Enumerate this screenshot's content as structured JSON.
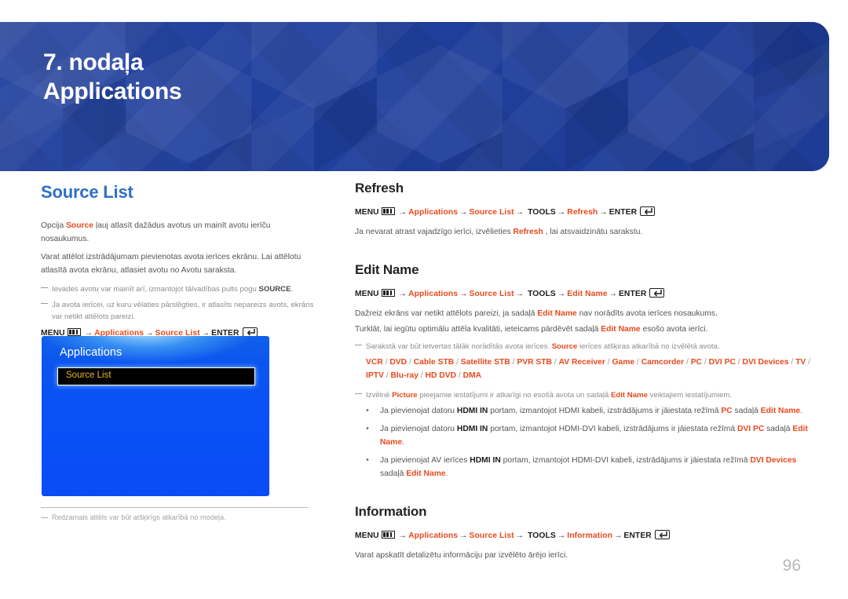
{
  "banner": {
    "chapter_number": "7. nodaļa",
    "chapter_title": "Applications",
    "bg_color": "#1f3f9d"
  },
  "page": {
    "number": "96"
  },
  "left_column": {
    "heading": "Source List",
    "heading_color": "#2e6fc7",
    "paragraph1_pre": "Opcija ",
    "paragraph1_kw": "Source",
    "paragraph1_post": " ļauj atlasīt dažādus avotus un mainīt avotu ierīču nosaukumus.",
    "paragraph2": "Varat attēlot izstrādājumam pievienotas avota ierīces ekrānu. Lai attēlotu atlasītā avota ekrānu, atlasiet avotu no Avotu saraksta.",
    "note1_pre": "Ievades avotu var mainīt arī, izmantojot tālvadības pults pogu ",
    "note1_kw": "SOURCE",
    "note1_post": ".",
    "note2": "Ja avota ierīcei, uz kuru vēlaties pārslēgties, ir atlasīts nepareizs avots, ekrāns var netikt attēlots pareizi.",
    "menu_path": {
      "menu_label": "MENU",
      "menu_icon": "menu-bars-icon",
      "steps": [
        "Applications",
        "Source List"
      ],
      "enter_label": "ENTER",
      "enter_icon": "enter-return-icon"
    },
    "tv_mockup": {
      "title": "Applications",
      "selected_item": "Source List",
      "selected_text_color": "#e8b62b"
    },
    "footnote": "Redzamais attēls var būt atšķirīgs atkarībā no modeļa."
  },
  "right_column": {
    "sections": [
      {
        "heading": "Refresh",
        "menu_path": {
          "menu_label": "MENU",
          "menu_icon": "menu-bars-icon",
          "steps": [
            "Applications",
            "Source List",
            "TOOLS",
            "Refresh"
          ],
          "enter_label": "ENTER",
          "enter_icon": "enter-return-icon"
        },
        "body_pre": "Ja nevarat atrast vajadzīgo ierīci, izvēlieties ",
        "body_kw": "Refresh",
        "body_post": " , lai atsvaidzinātu sarakstu."
      },
      {
        "heading": "Edit Name",
        "menu_path": {
          "menu_label": "MENU",
          "menu_icon": "menu-bars-icon",
          "steps": [
            "Applications",
            "Source List",
            "TOOLS",
            "Edit Name"
          ],
          "enter_label": "ENTER",
          "enter_icon": "enter-return-icon"
        },
        "para1_pre": "Dažreiz ekrāns var netikt attēlots pareizi, ja sadaļā ",
        "para1_kw": "Edit Name",
        "para1_post": " nav norādīts avota ierīces nosaukums.",
        "para2_pre": "Turklāt, lai iegūtu optimālu attēla kvalitāti, ieteicams pārdēvēt sadaļā ",
        "para2_kw": "Edit Name",
        "para2_post": " esošo avota ierīci.",
        "note1_pre": "Sarakstā var būt ietvertas tālāk norādītās avota ierīces. ",
        "note1_kw": "Source",
        "note1_post": " ierīces atšķiras atkarībā no izvēlētā avota.",
        "device_list": [
          "VCR",
          "DVD",
          "Cable STB",
          "Satellite STB",
          "PVR STB",
          "AV Receiver",
          "Game",
          "Camcorder",
          "PC",
          "DVI PC",
          "DVI Devices",
          "TV",
          "IPTV",
          "Blu-ray",
          "HD DVD",
          "DMA"
        ],
        "note2_pre": "Izvēlnē ",
        "note2_kw1": "Picture",
        "note2_mid": " pieejamie iestatījumi ir atkarīgi no esošā avota un sadaļā ",
        "note2_kw2": "Edit Name",
        "note2_post": " veiktajiem iestatījumiem.",
        "bullets": [
          {
            "seg1": "Ja pievienojat datoru ",
            "kw_black": "HDMI IN",
            "seg2": " portam, izmantojot HDMI kabeli, izstrādājums ir jāiestata režīmā ",
            "kw_red1": "PC",
            "seg3": " sadaļā ",
            "kw_red2": "Edit Name",
            "seg4": "."
          },
          {
            "seg1": "Ja pievienojat datoru ",
            "kw_black": "HDMI IN",
            "seg2": "  portam, izmantojot HDMI-DVI kabeli, izstrādājums ir jāiestata režīmā ",
            "kw_red1": "DVI PC",
            "seg3": " sadaļā ",
            "kw_red2": "Edit Name",
            "seg4": "."
          },
          {
            "seg1": "Ja pievienojat AV ierīces ",
            "kw_black": "HDMI IN",
            "seg2": " portam, izmantojot HDMI-DVI kabeli, izstrādājums ir jāiestata režīmā ",
            "kw_red1": "DVI Devices",
            "seg3": " sadaļā ",
            "kw_red2": "Edit Name",
            "seg4": "."
          }
        ]
      },
      {
        "heading": "Information",
        "menu_path": {
          "menu_label": "MENU",
          "menu_icon": "menu-bars-icon",
          "steps": [
            "Applications",
            "Source List",
            "TOOLS",
            "Information"
          ],
          "enter_label": "ENTER",
          "enter_icon": "enter-return-icon"
        },
        "body": "Varat apskatīt detalizētu informāciju par izvēlēto ārējo ierīci."
      }
    ]
  },
  "colors": {
    "accent_red": "#e8491d",
    "heading_blue": "#2e6fc7",
    "banner_blue": "#1f3f9d",
    "tv_blue": "#0a50f7"
  }
}
